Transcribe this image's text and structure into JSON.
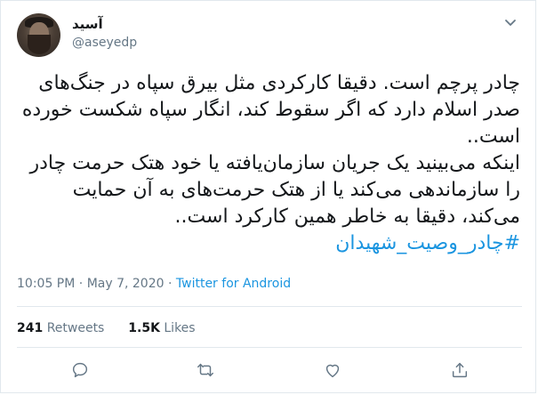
{
  "author": {
    "display_name": "آسید",
    "handle": "@aseyedp"
  },
  "tweet": {
    "lines": [
      "چادر پرچم است. دقیقا کارکردی مثل بیرق سپاه در جنگ‌های",
      "صدر اسلام دارد که اگر سقوط کند، انگار سپاه شکست خورده",
      "است..",
      "اینکه می‌بینید یک جریان سازمان‌یافته یا خود هتک حرمت چادر",
      "را سازماندهی می‌کند یا از هتک حرمت‌های به آن حمایت",
      "می‌کند، دقیقا به خاطر همین کارکرد است.."
    ],
    "hashtag": "#چادر_وصیت_شهیدان"
  },
  "meta": {
    "time": "10:05 PM",
    "separator": "·",
    "date": "May 7, 2020",
    "source": "Twitter for Android"
  },
  "stats": {
    "retweets_count": "241",
    "retweets_label": "Retweets",
    "likes_count": "1.5K",
    "likes_label": "Likes"
  },
  "actions": {
    "icons": [
      "reply-icon",
      "retweet-icon",
      "like-icon",
      "share-icon"
    ]
  },
  "colors": {
    "link": "#1b95e0",
    "secondary_text": "#657786",
    "primary_text": "#14171a",
    "divider": "#e1e8ed"
  }
}
